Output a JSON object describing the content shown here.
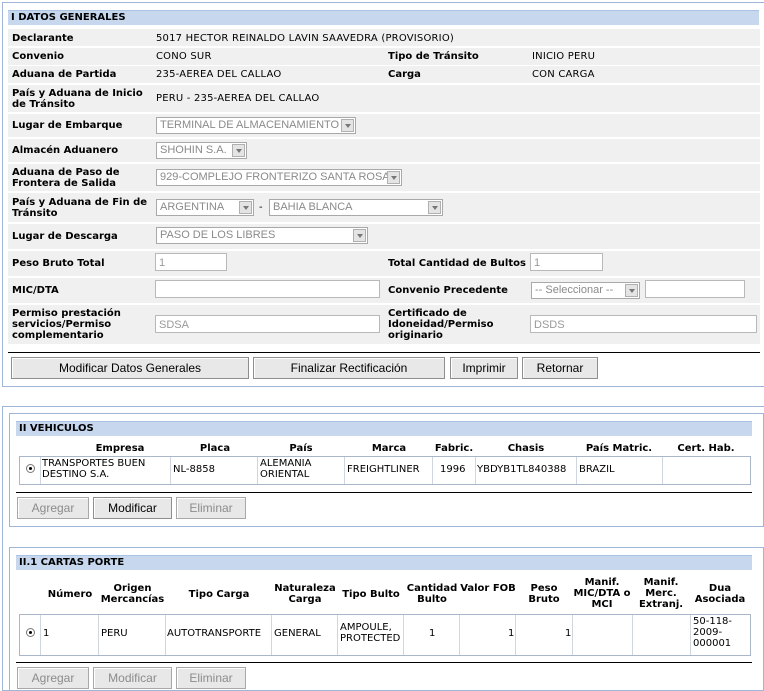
{
  "datos": {
    "header": "I DATOS GENERALES",
    "declarante_label": "Declarante",
    "declarante_value": "5017 HECTOR REINALDO LAVIN SAAVEDRA (PROVISORIO)",
    "convenio_label": "Convenio",
    "convenio_value": "CONO SUR",
    "tipo_transito_label": "Tipo de Tránsito",
    "tipo_transito_value": "INICIO PERU",
    "aduana_partida_label": "Aduana de Partida",
    "aduana_partida_value": "235-AEREA DEL CALLAO",
    "carga_label": "Carga",
    "carga_value": "CON CARGA",
    "pais_inicio_label": "País y Aduana de Inicio de Tránsito",
    "pais_inicio_value": "PERU - 235-AEREA DEL CALLAO",
    "lugar_embarque_label": "Lugar de Embarque",
    "lugar_embarque_value": "TERMINAL DE ALMACENAMIENTO",
    "almacen_label": "Almacén Aduanero",
    "almacen_value": "SHOHIN S.A.",
    "aduana_paso_label": "Aduana de Paso de Frontera de Salida",
    "aduana_paso_value": "929-COMPLEJO FRONTERIZO SANTA ROSA",
    "pais_fin_label": "País y Aduana de Fin de Tránsito",
    "pais_fin_value": "ARGENTINA",
    "pais_fin_dash": "-",
    "aduana_fin_value": "BAHIA BLANCA",
    "lugar_descarga_label": "Lugar de Descarga",
    "lugar_descarga_value": "PASO DE LOS LIBRES",
    "peso_label": "Peso Bruto Total",
    "peso_value": "1",
    "total_bultos_label": "Total Cantidad de Bultos",
    "total_bultos_value": "1",
    "mic_label": "MIC/DTA",
    "mic_value": "",
    "convenio_prec_label": "Convenio Precedente",
    "convenio_prec_value": "-- Seleccionar --",
    "convenio_prec_extra": "",
    "permiso_label": "Permiso prestación servicios/Permiso complementario",
    "permiso_value": "SDSA",
    "certificado_label": "Certificado de Idoneidad/Permiso originario",
    "certificado_value": "DSDS",
    "buttons": {
      "modificar": "Modificar Datos Generales",
      "finalizar": "Finalizar Rectificación",
      "imprimir": "Imprimir",
      "retornar": "Retornar"
    }
  },
  "vehiculos": {
    "header": "II VEHICULOS",
    "columns": [
      "Empresa",
      "Placa",
      "País",
      "Marca",
      "Fabric.",
      "Chasis",
      "País Matric.",
      "Cert. Hab."
    ],
    "row": {
      "empresa": "TRANSPORTES BUEN DESTINO S.A.",
      "placa": "NL-8858",
      "pais": "ALEMANIA ORIENTAL",
      "marca": "FREIGHTLINER",
      "fabric": "1996",
      "chasis": "YBDYB1TL840388",
      "pais_matric": "BRAZIL",
      "cert_hab": ""
    },
    "buttons": {
      "agregar": "Agregar",
      "modificar": "Modificar",
      "eliminar": "Eliminar"
    }
  },
  "cartas": {
    "header": "II.1 CARTAS PORTE",
    "columns": [
      "Número",
      "Origen Mercancías",
      "Tipo Carga",
      "Naturaleza Carga",
      "Tipo Bulto",
      "Cantidad Bulto",
      "Valor FOB",
      "Peso Bruto",
      "Manif. MIC/DTA o MCI",
      "Manif. Merc. Extranj.",
      "Dua Asociada"
    ],
    "row": {
      "numero": "1",
      "origen": "PERU",
      "tipo_carga": "AUTOTRANSPORTE",
      "naturaleza": "GENERAL",
      "tipo_bulto": "AMPOULE, PROTECTED",
      "cantidad": "1",
      "valor_fob": "1",
      "peso": "1",
      "manif_mic": "",
      "manif_merc": "",
      "dua": "50-118-2009-000001"
    },
    "buttons": {
      "agregar": "Agregar",
      "modificar": "Modificar",
      "eliminar": "Eliminar"
    }
  }
}
